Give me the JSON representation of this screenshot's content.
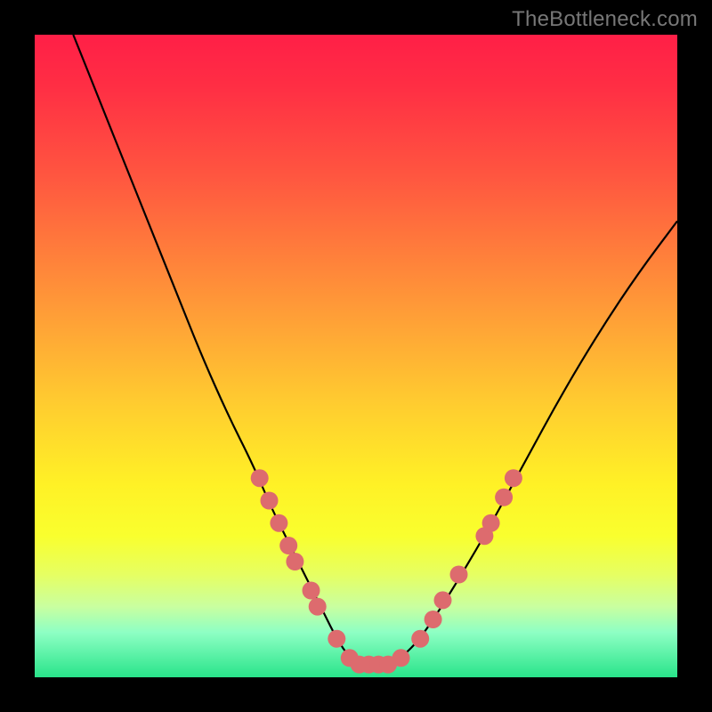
{
  "watermark": "TheBottleneck.com",
  "colors": {
    "background_frame": "#000000",
    "gradient_top": "#ff1f47",
    "gradient_bottom": "#29e48a",
    "curve": "#000000",
    "marker": "#dd6b6e"
  },
  "chart_data": {
    "type": "line",
    "title": "",
    "xlabel": "",
    "ylabel": "",
    "xlim": [
      0,
      100
    ],
    "ylim": [
      0,
      100
    ],
    "notes": "V-shaped bottleneck curve with flat minimum near center; axes/ticks not shown. Y values estimated as percent of plot height from bottom (0=bottom, 100=top).",
    "series": [
      {
        "name": "bottleneck-curve",
        "x": [
          6,
          10,
          14,
          18,
          22,
          26,
          30,
          34,
          37,
          40,
          43,
          45,
          47,
          49,
          51,
          53,
          55,
          57,
          60,
          64,
          70,
          76,
          82,
          88,
          94,
          100
        ],
        "y": [
          100,
          90,
          80,
          70,
          60,
          50,
          41,
          33,
          26,
          20,
          14,
          10,
          6,
          3,
          2,
          2,
          2,
          3,
          6,
          12,
          22,
          33,
          44,
          54,
          63,
          71
        ]
      }
    ],
    "markers": {
      "name": "highlighted-points",
      "points": [
        {
          "x": 35,
          "y": 31
        },
        {
          "x": 36.5,
          "y": 27.5
        },
        {
          "x": 38,
          "y": 24
        },
        {
          "x": 39.5,
          "y": 20.5
        },
        {
          "x": 40.5,
          "y": 18
        },
        {
          "x": 43,
          "y": 13.5
        },
        {
          "x": 44,
          "y": 11
        },
        {
          "x": 47,
          "y": 6
        },
        {
          "x": 49,
          "y": 3
        },
        {
          "x": 50.5,
          "y": 2
        },
        {
          "x": 52,
          "y": 2
        },
        {
          "x": 53.5,
          "y": 2
        },
        {
          "x": 55,
          "y": 2
        },
        {
          "x": 57,
          "y": 3
        },
        {
          "x": 60,
          "y": 6
        },
        {
          "x": 62,
          "y": 9
        },
        {
          "x": 63.5,
          "y": 12
        },
        {
          "x": 66,
          "y": 16
        },
        {
          "x": 70,
          "y": 22
        },
        {
          "x": 71,
          "y": 24
        },
        {
          "x": 73,
          "y": 28
        },
        {
          "x": 74.5,
          "y": 31
        }
      ]
    }
  }
}
